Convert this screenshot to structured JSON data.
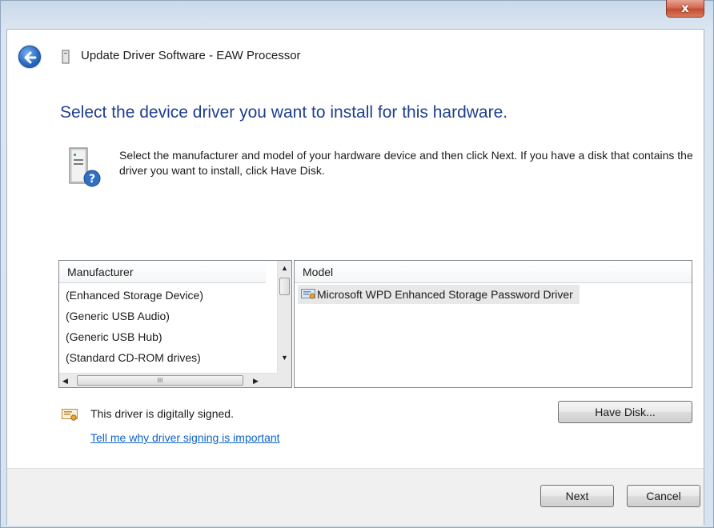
{
  "window": {
    "title": "Update Driver Software - EAW Processor",
    "close_label": "x"
  },
  "main": {
    "instruction": "Select the device driver you want to install for this hardware.",
    "description": "Select the manufacturer and model of your hardware device and then click Next. If you have a disk that contains the driver you want to install, click Have Disk."
  },
  "manufacturer_list": {
    "header": "Manufacturer",
    "items": [
      "(Enhanced Storage Device)",
      "(Generic USB Audio)",
      "(Generic USB Hub)",
      "(Standard CD-ROM drives)"
    ],
    "scroll_thumb_label": "III"
  },
  "model_list": {
    "header": "Model",
    "items": [
      "Microsoft WPD Enhanced Storage Password Driver"
    ]
  },
  "signature": {
    "text": "This driver is digitally signed.",
    "link": "Tell me why driver signing is important"
  },
  "buttons": {
    "have_disk": "Have Disk...",
    "next": "Next",
    "cancel": "Cancel"
  },
  "colors": {
    "instruction_blue": "#1e3f8f",
    "link_blue": "#0e63c8",
    "selection_gray": "#e8e8e8"
  },
  "icons": {
    "back": "back-arrow-icon",
    "device": "device-icon",
    "hardware_help": "hardware-help-icon",
    "certificate": "certificate-icon"
  }
}
